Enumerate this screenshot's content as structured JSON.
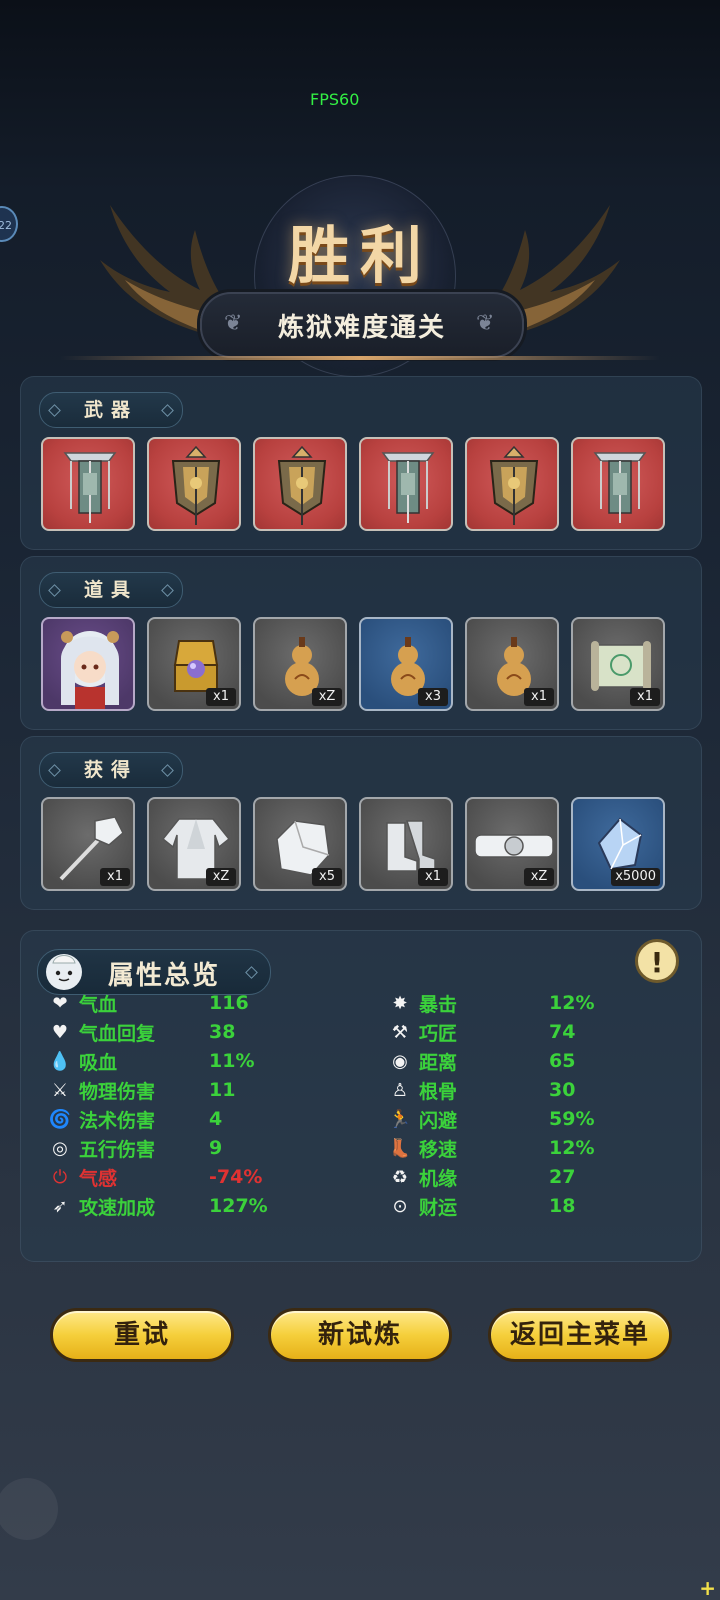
{
  "hud": {
    "fps": "FPS60",
    "side_badge": "22"
  },
  "header": {
    "title": "胜利",
    "subtitle": "炼狱难度通关"
  },
  "weapons": {
    "label": "武器",
    "items": [
      {
        "icon": "banner-icon",
        "color": "red"
      },
      {
        "icon": "flag-icon",
        "color": "red"
      },
      {
        "icon": "flag-icon",
        "color": "red"
      },
      {
        "icon": "banner-icon",
        "color": "red"
      },
      {
        "icon": "flag-icon",
        "color": "red"
      },
      {
        "icon": "banner-icon",
        "color": "red"
      }
    ]
  },
  "props": {
    "label": "道具",
    "items": [
      {
        "icon": "character-portrait-icon",
        "color": "purple",
        "qty": ""
      },
      {
        "icon": "treasure-box-icon",
        "color": "gray",
        "qty": "x1"
      },
      {
        "icon": "gourd-icon",
        "color": "gray",
        "qty": "xZ"
      },
      {
        "icon": "gourd-icon",
        "color": "blue",
        "qty": "x3"
      },
      {
        "icon": "gourd-icon",
        "color": "gray",
        "qty": "x1"
      },
      {
        "icon": "scroll-icon",
        "color": "gray",
        "qty": "x1"
      }
    ]
  },
  "obtained": {
    "label": "获得",
    "items": [
      {
        "icon": "staff-icon",
        "color": "gray",
        "qty": "x1"
      },
      {
        "icon": "robe-icon",
        "color": "gray",
        "qty": "xZ"
      },
      {
        "icon": "bracer-icon",
        "color": "gray",
        "qty": "x5"
      },
      {
        "icon": "boots-icon",
        "color": "gray",
        "qty": "x1"
      },
      {
        "icon": "belt-icon",
        "color": "gray",
        "qty": "xZ"
      },
      {
        "icon": "crystal-icon",
        "color": "blue",
        "qty": "x5000"
      }
    ]
  },
  "attributes": {
    "title": "属性总览",
    "left": [
      {
        "icon": "heart-icon",
        "glyph": "❤",
        "label": "气血",
        "value": "116"
      },
      {
        "icon": "heart-regen-icon",
        "glyph": "♥",
        "label": "气血回复",
        "value": "38"
      },
      {
        "icon": "drop-icon",
        "glyph": "💧",
        "label": "吸血",
        "value": "11%"
      },
      {
        "icon": "sword-icon",
        "glyph": "⚔",
        "label": "物理伤害",
        "value": "11"
      },
      {
        "icon": "spiral-icon",
        "glyph": "🌀",
        "label": "法术伤害",
        "value": "4"
      },
      {
        "icon": "swirl-icon",
        "glyph": "◎",
        "label": "五行伤害",
        "value": "9"
      },
      {
        "icon": "power-icon",
        "glyph": "⏻",
        "label": "气感",
        "value": "-74%",
        "negative": true
      },
      {
        "icon": "attack-speed-icon",
        "glyph": "➶",
        "label": "攻速加成",
        "value": "127%"
      }
    ],
    "right": [
      {
        "icon": "crit-icon",
        "glyph": "✸",
        "label": "暴击",
        "value": "12%"
      },
      {
        "icon": "hammer-icon",
        "glyph": "⚒",
        "label": "巧匠",
        "value": "74"
      },
      {
        "icon": "target-icon",
        "glyph": "◉",
        "label": "距离",
        "value": "65"
      },
      {
        "icon": "meditate-icon",
        "glyph": "♙",
        "label": "根骨",
        "value": "30"
      },
      {
        "icon": "dodge-icon",
        "glyph": "🏃",
        "label": "闪避",
        "value": "59%"
      },
      {
        "icon": "boot-icon",
        "glyph": "👢",
        "label": "移速",
        "value": "12%"
      },
      {
        "icon": "fortune-cycle-icon",
        "glyph": "♻",
        "label": "机缘",
        "value": "27"
      },
      {
        "icon": "coin-icon",
        "glyph": "⊙",
        "label": "财运",
        "value": "18"
      }
    ]
  },
  "buttons": {
    "retry": "重试",
    "new_trial": "新试炼",
    "main_menu": "返回主菜单"
  },
  "colors": {
    "stat_green": "#3bd23b",
    "stat_red": "#e03232",
    "button_yellow": "#f5cf3b",
    "slot_red": "#b8413f",
    "slot_blue": "#2a4f7c"
  }
}
